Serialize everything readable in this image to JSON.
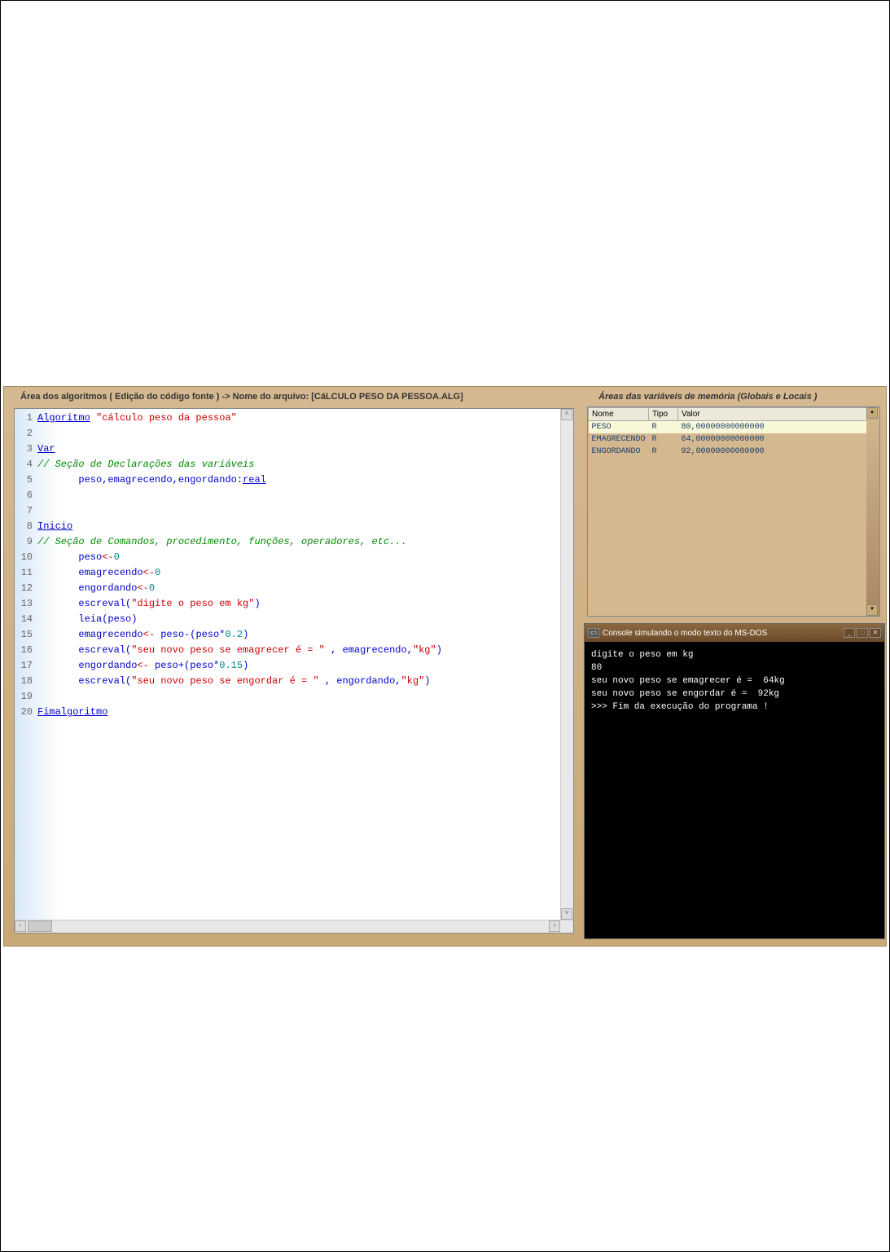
{
  "editor": {
    "legend": "Área dos algoritmos ( Edição do código fonte ) -> Nome do arquivo: [CáLCULO PESO DA PESSOA.ALG]",
    "lines": [
      {
        "n": "1",
        "segments": [
          {
            "t": "Algoritmo",
            "c": "kw-underline"
          },
          {
            "t": " ",
            "c": ""
          },
          {
            "t": "\"cálculo peso da pessoa\"",
            "c": "str-red"
          }
        ]
      },
      {
        "n": "2",
        "segments": []
      },
      {
        "n": "3",
        "segments": [
          {
            "t": "Var",
            "c": "kw-underline"
          }
        ]
      },
      {
        "n": "4",
        "segments": [
          {
            "t": "// Seção de Declarações das variáveis",
            "c": "comment-green"
          }
        ]
      },
      {
        "n": "5",
        "segments": [
          {
            "t": "       peso,emagrecendo,engordando:",
            "c": "kw-blue"
          },
          {
            "t": "real",
            "c": "kw-underline"
          }
        ]
      },
      {
        "n": "6",
        "segments": []
      },
      {
        "n": "7",
        "segments": []
      },
      {
        "n": "8",
        "segments": [
          {
            "t": "Inicio",
            "c": "kw-underline"
          }
        ]
      },
      {
        "n": "9",
        "segments": [
          {
            "t": "// Seção de Comandos, procedimento, funções, operadores, etc...",
            "c": "comment-green"
          }
        ]
      },
      {
        "n": "10",
        "segments": [
          {
            "t": "       peso",
            "c": "kw-blue"
          },
          {
            "t": "<-",
            "c": "str-red"
          },
          {
            "t": "0",
            "c": "number-teal"
          }
        ]
      },
      {
        "n": "11",
        "segments": [
          {
            "t": "       emagrecendo",
            "c": "kw-blue"
          },
          {
            "t": "<-",
            "c": "str-red"
          },
          {
            "t": "0",
            "c": "number-teal"
          }
        ]
      },
      {
        "n": "12",
        "segments": [
          {
            "t": "       engordando",
            "c": "kw-blue"
          },
          {
            "t": "<-",
            "c": "str-red"
          },
          {
            "t": "0",
            "c": "number-teal"
          }
        ]
      },
      {
        "n": "13",
        "segments": [
          {
            "t": "       escreval(",
            "c": "kw-blue"
          },
          {
            "t": "\"digite o peso em kg\"",
            "c": "str-red"
          },
          {
            "t": ")",
            "c": "kw-blue"
          }
        ]
      },
      {
        "n": "14",
        "segments": [
          {
            "t": "       leia(peso)",
            "c": "kw-blue"
          }
        ]
      },
      {
        "n": "15",
        "segments": [
          {
            "t": "       emagrecendo",
            "c": "kw-blue"
          },
          {
            "t": "<-",
            "c": "str-red"
          },
          {
            "t": " peso-(peso*",
            "c": "kw-blue"
          },
          {
            "t": "0.2",
            "c": "number-teal"
          },
          {
            "t": ")",
            "c": "kw-blue"
          }
        ]
      },
      {
        "n": "16",
        "segments": [
          {
            "t": "       escreval(",
            "c": "kw-blue"
          },
          {
            "t": "\"seu novo peso se emagrecer é = \"",
            "c": "str-red"
          },
          {
            "t": " , emagrecendo,",
            "c": "kw-blue"
          },
          {
            "t": "\"kg\"",
            "c": "str-red"
          },
          {
            "t": ")",
            "c": "kw-blue"
          }
        ]
      },
      {
        "n": "17",
        "segments": [
          {
            "t": "       engordando",
            "c": "kw-blue"
          },
          {
            "t": "<-",
            "c": "str-red"
          },
          {
            "t": " peso+(peso*",
            "c": "kw-blue"
          },
          {
            "t": "0.15",
            "c": "number-teal"
          },
          {
            "t": ")",
            "c": "kw-blue"
          }
        ]
      },
      {
        "n": "18",
        "segments": [
          {
            "t": "       escreval(",
            "c": "kw-blue"
          },
          {
            "t": "\"seu novo peso se engordar é = \"",
            "c": "str-red"
          },
          {
            "t": " , engordando,",
            "c": "kw-blue"
          },
          {
            "t": "\"kg\"",
            "c": "str-red"
          },
          {
            "t": ")",
            "c": "kw-blue"
          }
        ]
      },
      {
        "n": "19",
        "segments": []
      },
      {
        "n": "20",
        "segments": [
          {
            "t": "Fimalgoritmo",
            "c": "kw-underline"
          }
        ]
      }
    ]
  },
  "vars": {
    "legend": "Áreas das variáveis de memória (Globais e Locais )",
    "headers": {
      "name": "Nome",
      "type": "Tipo",
      "value": "Valor"
    },
    "rows": [
      {
        "name": "PESO",
        "type": "R",
        "value": "80,00000000000000",
        "hl": true
      },
      {
        "name": "EMAGRECENDO",
        "type": "R",
        "value": "64,00000000000000",
        "hl": false
      },
      {
        "name": "ENGORDANDO",
        "type": "R",
        "value": "92,00000000000000",
        "hl": false
      }
    ]
  },
  "console": {
    "title": "Console simulando o modo texto do MS-DOS",
    "lines": [
      "digite o peso em kg",
      "80",
      "seu novo peso se emagrecer é =  64kg",
      "seu novo peso se engordar é =  92kg",
      "",
      ">>> Fim da execução do programa !"
    ]
  }
}
